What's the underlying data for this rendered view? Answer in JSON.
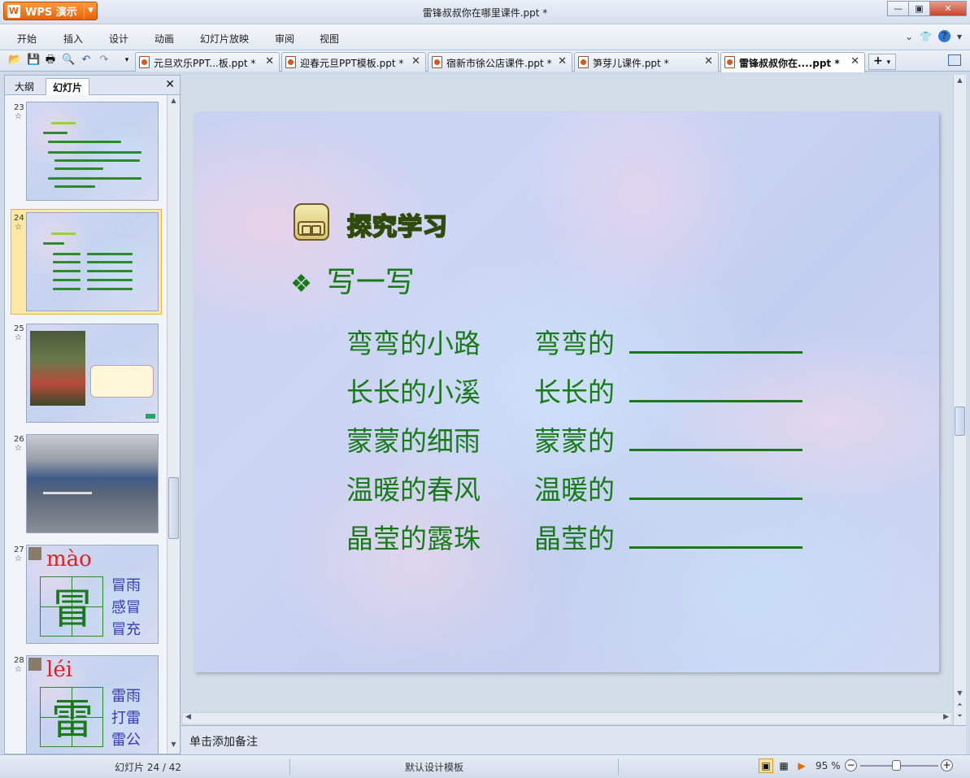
{
  "app": {
    "button_label": "WPS 演示",
    "window_title": "雷锋叔叔你在哪里课件.ppt *"
  },
  "menu": {
    "items": [
      "开始",
      "插入",
      "设计",
      "动画",
      "幻灯片放映",
      "审阅",
      "视图"
    ]
  },
  "doc_tabs": [
    {
      "label": "元旦欢乐PPT...板.ppt *",
      "active": false
    },
    {
      "label": "迎春元旦PPT模板.ppt *",
      "active": false
    },
    {
      "label": "宿新市徐公店课件.ppt *",
      "active": false
    },
    {
      "label": "笋芽儿课件.ppt *",
      "active": false
    },
    {
      "label": "雷锋叔叔你在....ppt *",
      "active": true
    }
  ],
  "left_panel": {
    "tabs": [
      "大纲",
      "幻灯片"
    ],
    "active_tab": "幻灯片",
    "slides": [
      {
        "number": "23",
        "kind": "text"
      },
      {
        "number": "24",
        "kind": "text",
        "selected": true
      },
      {
        "number": "25",
        "kind": "photo"
      },
      {
        "number": "26",
        "kind": "photo"
      },
      {
        "number": "27",
        "kind": "char",
        "pinyin": "mào",
        "char": "冒",
        "words": [
          "冒雨",
          "感冒",
          "冒充"
        ]
      },
      {
        "number": "28",
        "kind": "char",
        "pinyin": "léi",
        "char": "雷",
        "words": [
          "雷雨",
          "打雷",
          "雷公"
        ]
      }
    ]
  },
  "slide": {
    "heading": "探究学习",
    "subhead": "写一写",
    "bullet": "❖",
    "rows": [
      {
        "left": "弯弯的小路",
        "right": "弯弯的"
      },
      {
        "left": "长长的小溪",
        "right": "长长的"
      },
      {
        "left": "蒙蒙的细雨",
        "right": "蒙蒙的"
      },
      {
        "left": "温暖的春风",
        "right": "温暖的"
      },
      {
        "left": "晶莹的露珠",
        "right": "晶莹的"
      }
    ]
  },
  "notes": {
    "placeholder": "单击添加备注"
  },
  "status": {
    "slide_info": "幻灯片 24 / 42",
    "template": "默认设计模板",
    "zoom": "95 %"
  },
  "colors": {
    "slide_text": "#1a7a1a",
    "app_orange": "#e8620b",
    "heading_fill": "#b6e02a"
  }
}
